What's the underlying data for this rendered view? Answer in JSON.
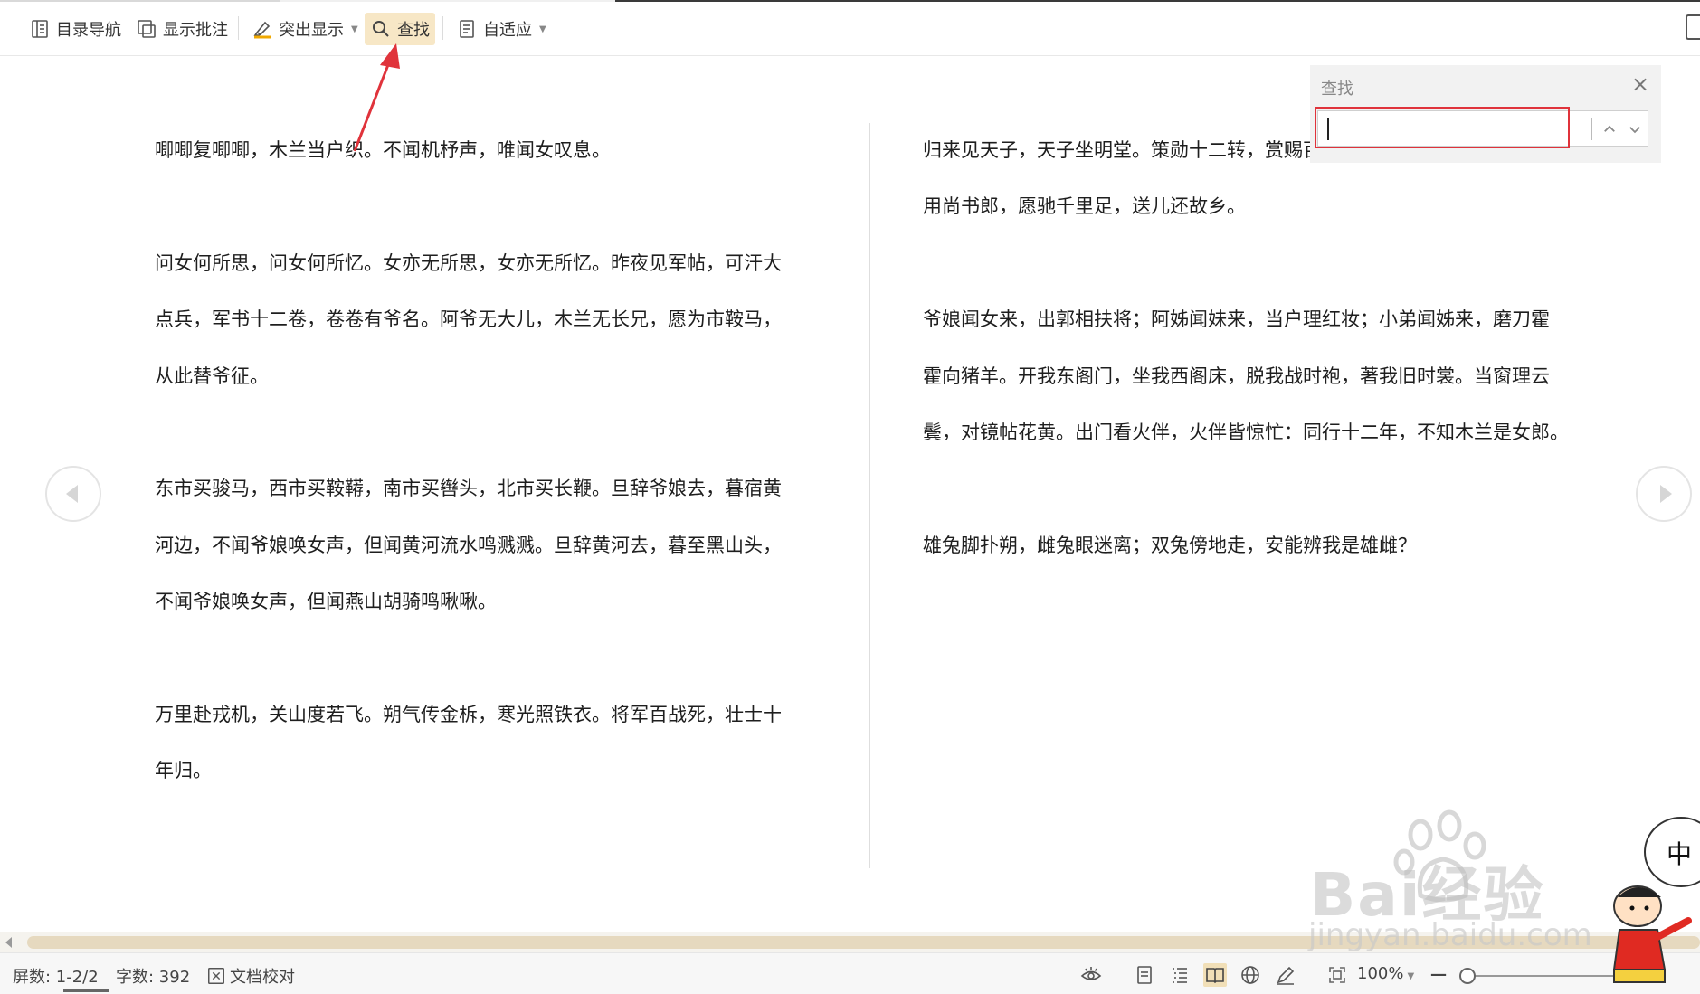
{
  "toolbar": {
    "items": [
      {
        "label": "目录导航",
        "icon": "toc-nav-icon"
      },
      {
        "label": "显示批注",
        "icon": "comments-icon"
      },
      {
        "label": "突出显示",
        "icon": "highlighter-icon"
      },
      {
        "label": "查找",
        "icon": "search-icon"
      },
      {
        "label": "自适应",
        "icon": "fit-page-icon"
      }
    ]
  },
  "document": {
    "left_paragraphs": [
      [
        "唧唧复唧唧，木兰当户织。不闻机杼声，唯闻女叹息。"
      ],
      [
        "问女何所思，问女何所忆。女亦无所思，女亦无所忆。昨夜见军帖，可汗大",
        "点兵，军书十二卷，卷卷有爷名。阿爷无大儿，木兰无长兄，愿为市鞍马，",
        "从此替爷征。"
      ],
      [
        "东市买骏马，西市买鞍鞯，南市买辔头，北市买长鞭。旦辞爷娘去，暮宿黄",
        "河边，不闻爷娘唤女声，但闻黄河流水鸣溅溅。旦辞黄河去，暮至黑山头，",
        "不闻爷娘唤女声，但闻燕山胡骑鸣啾啾。"
      ],
      [
        "万里赴戎机，关山度若飞。朔气传金柝，寒光照铁衣。将军百战死，壮士十",
        "年归。"
      ]
    ],
    "right_paragraphs": [
      [
        "归来见天子，天子坐明堂。策勋十二转，赏赐百千强。可汗问所欲，木兰不",
        "用尚书郎，愿驰千里足，送儿还故乡。"
      ],
      [
        "爷娘闻女来，出郭相扶将；阿姊闻妹来，当户理红妆；小弟闻姊来，磨刀霍",
        "霍向猪羊。开我东阁门，坐我西阁床，脱我战时袍，著我旧时裳。当窗理云",
        "鬓，对镜帖花黄。出门看火伴，火伴皆惊忙：同行十二年，不知木兰是女郎。"
      ],
      [
        "雄兔脚扑朔，雌兔眼迷离；双兔傍地走，安能辨我是雄雌？"
      ]
    ]
  },
  "find_panel": {
    "title": "查找",
    "input_value": ""
  },
  "statusbar": {
    "screens": "屏数: 1-2/2",
    "word_count": "字数: 392",
    "proofread": "文档校对",
    "zoom": "100%"
  },
  "watermark": {
    "brand": "Bai经验",
    "url": "jingyan.baidu.com",
    "mascot_char": "中"
  },
  "colors": {
    "accent_active": "#f7e7c6",
    "annotation_red": "#e0333b",
    "scroll_thumb": "#e6d9bf"
  }
}
